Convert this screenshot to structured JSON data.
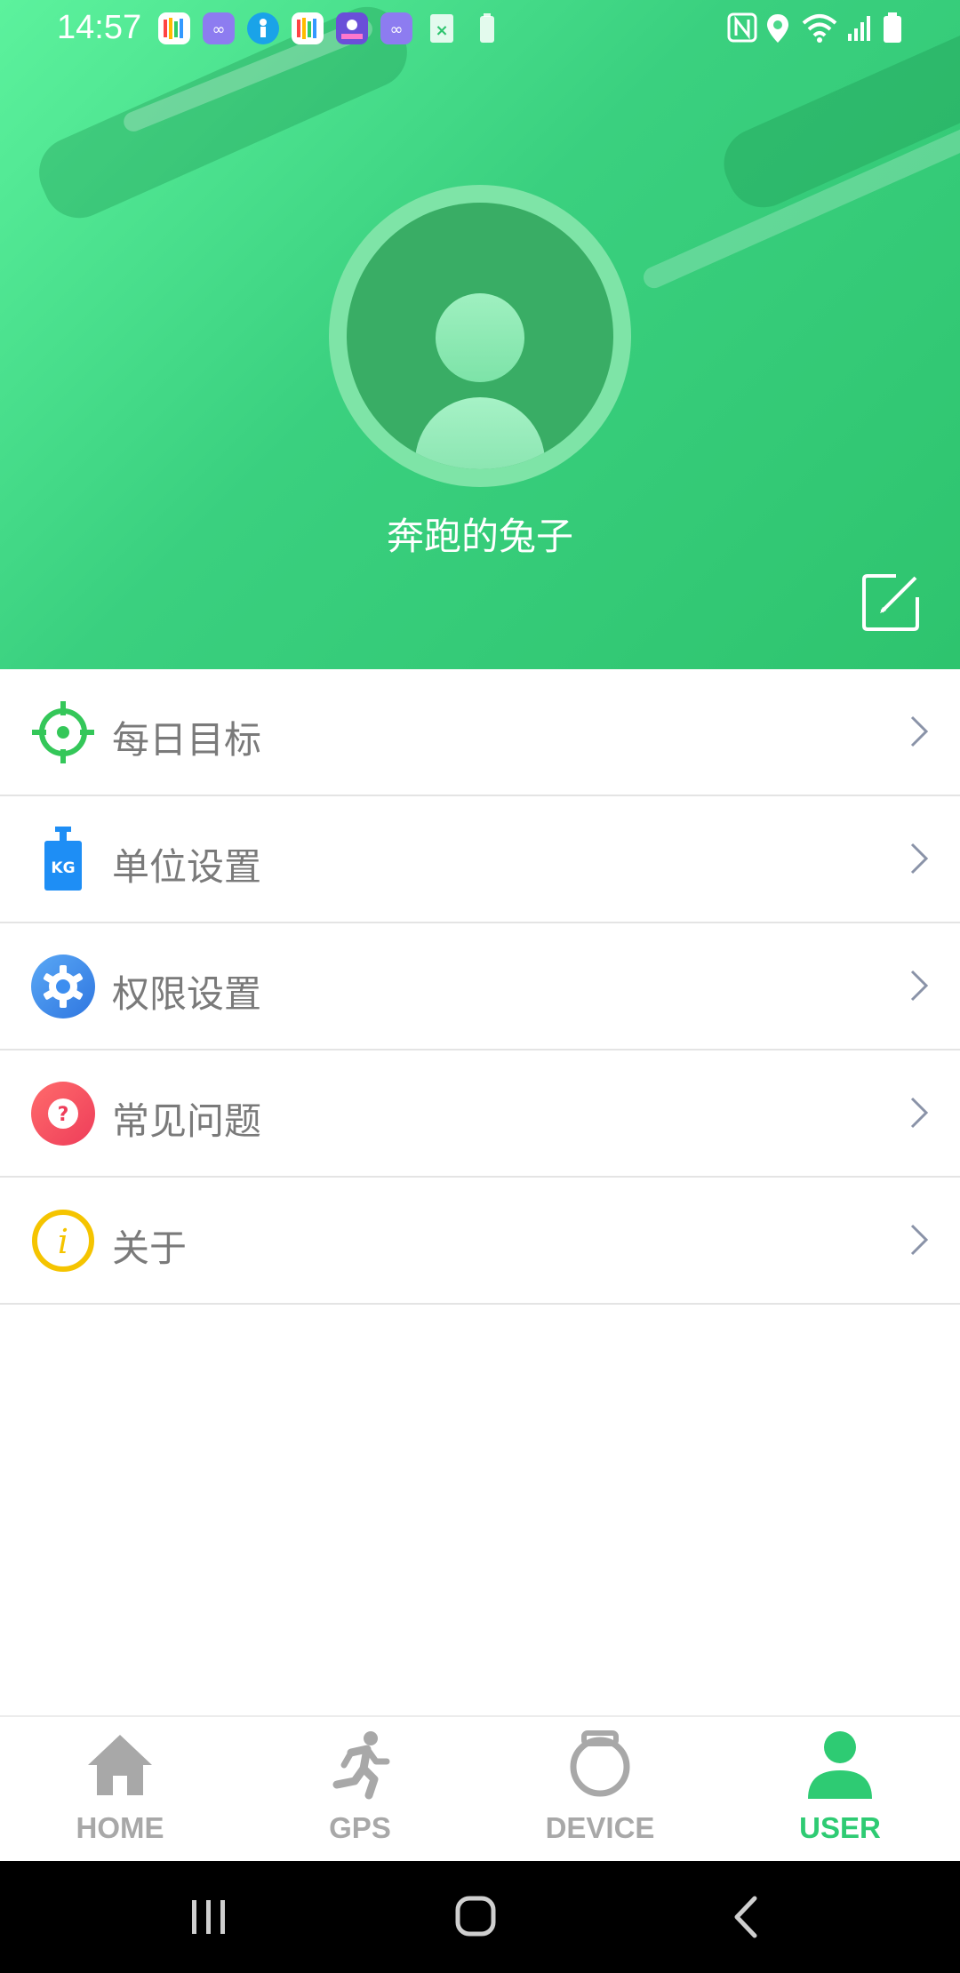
{
  "status_bar": {
    "time": "14:57",
    "notification_icons": [
      "heart-rate-app-icon",
      "loop-app-icon",
      "fitness-app-icon",
      "heart-rate-app-icon",
      "map-app-icon",
      "loop-app-icon",
      "excel-icon",
      "battery-saver-icon"
    ],
    "system_icons": [
      "nfc-icon",
      "location-icon",
      "wifi-icon",
      "signal-icon",
      "battery-icon"
    ]
  },
  "profile": {
    "username": "奔跑的兔子"
  },
  "menu": {
    "items": [
      {
        "label": "每日目标",
        "icon": "target-icon",
        "color": "#34c759"
      },
      {
        "label": "单位设置",
        "icon": "kg-weight-icon",
        "color": "#1e8ef5"
      },
      {
        "label": "权限设置",
        "icon": "gear-icon",
        "color": "#3d8ef0"
      },
      {
        "label": "常见问题",
        "icon": "question-icon",
        "color": "#f5475c"
      },
      {
        "label": "关于",
        "icon": "info-icon",
        "color": "#f5c400"
      }
    ]
  },
  "bottom_nav": {
    "tabs": [
      {
        "label": "HOME",
        "icon": "home-icon",
        "active": false
      },
      {
        "label": "GPS",
        "icon": "running-icon",
        "active": false
      },
      {
        "label": "DEVICE",
        "icon": "watch-icon",
        "active": false
      },
      {
        "label": "USER",
        "icon": "user-icon",
        "active": true
      }
    ]
  },
  "colors": {
    "accent": "#2ecb73",
    "header_gradient_start": "#5cf29d",
    "header_gradient_end": "#2ec46e",
    "inactive": "#a8a8a8"
  }
}
